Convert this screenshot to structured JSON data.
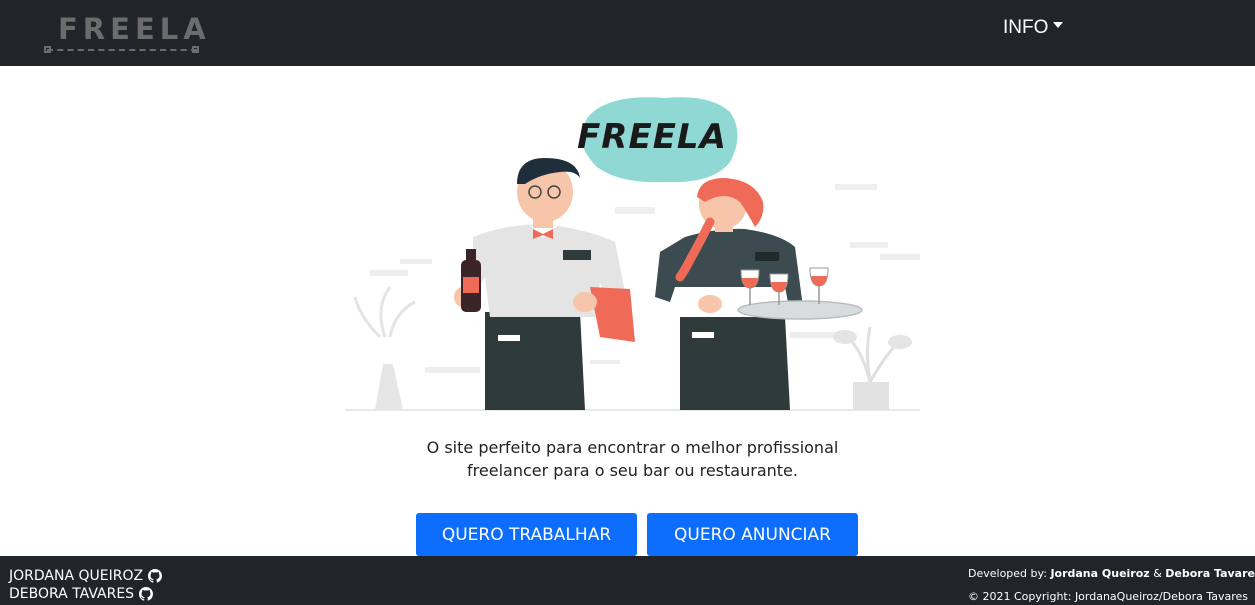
{
  "navbar": {
    "logo_text": "FREELA",
    "info_label": "INFO"
  },
  "hero": {
    "brand_text": "FREELA"
  },
  "tagline": {
    "line1": "O site perfeito para encontrar o melhor profissional",
    "line2": "freelancer para o seu bar ou restaurante."
  },
  "actions": {
    "work_label": "QUERO TRABALHAR",
    "announce_label": "QUERO ANUNCIAR"
  },
  "footer": {
    "dev1": "JORDANA QUEIROZ",
    "dev2": "DEBORA TAVARES",
    "developed_by": "Developed by:",
    "dev1_name": "Jordana Queiroz",
    "amp": "&",
    "dev2_name": "Debora Tavares",
    "copyright": "© 2021 Copyright: JordanaQueiroz/Debora Tavares"
  },
  "colors": {
    "navbar_bg": "#212529",
    "button_primary": "#0d6efd",
    "accent_teal": "#8fd8d3",
    "accent_coral": "#ef6b57"
  },
  "icons": [
    "github-icon",
    "caret-down-icon"
  ]
}
